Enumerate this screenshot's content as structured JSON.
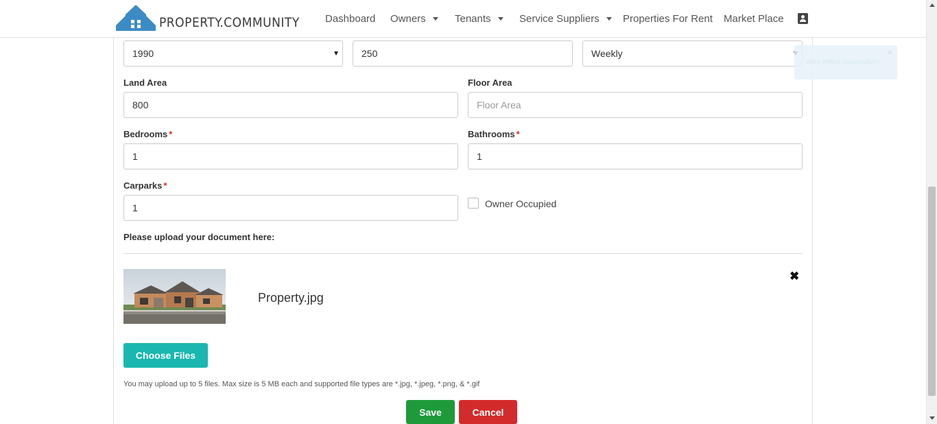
{
  "brand": {
    "name": "PROPERTY.COMMUNITY",
    "logo_color": "#3d8bc4"
  },
  "nav": {
    "dashboard": "Dashboard",
    "owners": "Owners",
    "tenants": "Tenants",
    "service_suppliers": "Service Suppliers",
    "properties_for_rent": "Properties For Rent",
    "market_place": "Market Place",
    "profile_icon": "contact-card-icon"
  },
  "form": {
    "year_built": "1990",
    "rent_amount": "250",
    "rent_frequency": "Weekly",
    "land_area": {
      "label": "Land Area",
      "value": "800"
    },
    "floor_area": {
      "label": "Floor Area",
      "placeholder": "Floor Area"
    },
    "bedrooms": {
      "label": "Bedrooms",
      "required": "*",
      "value": "1"
    },
    "bathrooms": {
      "label": "Bathrooms",
      "required": "*",
      "value": "1"
    },
    "carparks": {
      "label": "Carparks",
      "required": "*",
      "value": "1"
    },
    "owner_occupied": {
      "label": "Owner Occupied",
      "checked": false
    }
  },
  "upload": {
    "label": "Please upload your document here:",
    "file_name": "Property.jpg",
    "choose_label": "Choose Files",
    "hint": "You may upload up to 5 files. Max size is 5 MB each and supported file types are *.jpg, *.jpeg, *.png, & *.gif"
  },
  "actions": {
    "save": "Save",
    "cancel": "Cancel"
  },
  "toast": {
    "message": "Item edited successfully",
    "close": "×"
  },
  "colors": {
    "choose": "#1ab7b0",
    "save": "#1e9a3a",
    "cancel": "#d32b2b",
    "required": "#d9302c"
  }
}
